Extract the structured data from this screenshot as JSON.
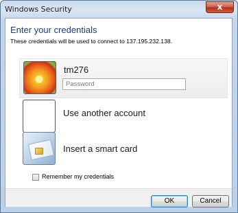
{
  "window": {
    "title": "Windows Security",
    "close_glyph": "x"
  },
  "heading": "Enter your credentials",
  "subtext": "These credentials will be used to connect to 137.195.232.138.",
  "accounts": [
    {
      "label": "tm276",
      "icon": "flower-user-icon",
      "password_placeholder": "Password"
    },
    {
      "label": "Use another account",
      "icon": "blank-user-icon"
    },
    {
      "label": "Insert a smart card",
      "icon": "smart-card-icon"
    }
  ],
  "remember": {
    "label": "Remember my credentials",
    "checked": false
  },
  "buttons": {
    "ok": "OK",
    "cancel": "Cancel"
  }
}
